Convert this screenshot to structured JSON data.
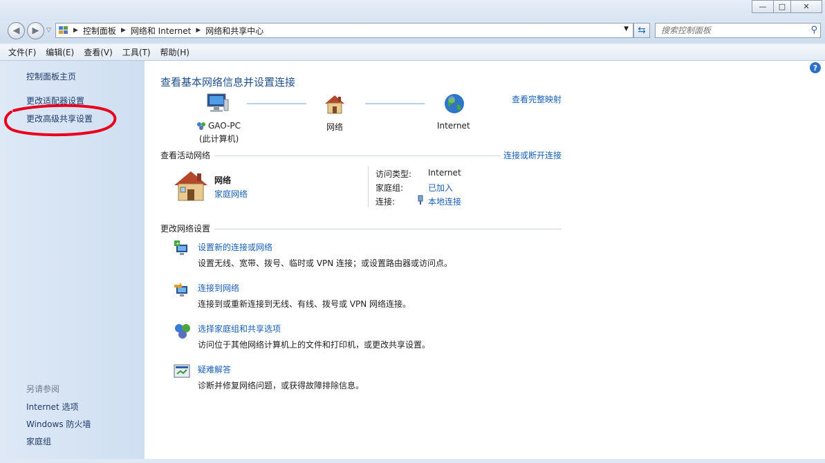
{
  "window": {
    "minimize_label": "—",
    "maximize_label": "□",
    "close_label": "✕"
  },
  "nav": {
    "back_label": "◀",
    "forward_label": "▶",
    "breadcrumb": [
      "控制面板",
      "网络和 Internet",
      "网络和共享中心"
    ],
    "search_placeholder": "搜索控制面板"
  },
  "menu": [
    "文件(F)",
    "编辑(E)",
    "查看(V)",
    "工具(T)",
    "帮助(H)"
  ],
  "sidebar": {
    "home": "控制面板主页",
    "items": [
      "更改适配器设置",
      "更改高级共享设置"
    ],
    "see_also_heading": "另请参阅",
    "see_also": [
      "Internet 选项",
      "Windows 防火墙",
      "家庭组"
    ]
  },
  "main": {
    "title": "查看基本网络信息并设置连接",
    "full_map_link": "查看完整映射",
    "map": {
      "computer_name": "GAO-PC",
      "computer_sub": "(此计算机)",
      "network": "网络",
      "internet": "Internet"
    },
    "active": {
      "title": "查看活动网络",
      "connect_link": "连接或断开连接",
      "network_name": "网络",
      "network_type": "家庭网络",
      "access_type_label": "访问类型:",
      "access_type_value": "Internet",
      "homegroup_label": "家庭组:",
      "homegroup_value": "已加入",
      "connection_label": "连接:",
      "connection_value": "本地连接"
    },
    "change": {
      "title": "更改网络设置",
      "tasks": [
        {
          "title": "设置新的连接或网络",
          "desc": "设置无线、宽带、拨号、临时或 VPN 连接；或设置路由器或访问点。"
        },
        {
          "title": "连接到网络",
          "desc": "连接到或重新连接到无线、有线、拨号或 VPN 网络连接。"
        },
        {
          "title": "选择家庭组和共享选项",
          "desc": "访问位于其他网络计算机上的文件和打印机，或更改共享设置。"
        },
        {
          "title": "疑难解答",
          "desc": "诊断并修复网络问题，或获得故障排除信息。"
        }
      ]
    },
    "help_label": "?"
  },
  "colors": {
    "link": "#1a5fb4",
    "title": "#1f4e8c",
    "annotation": "#e8001c"
  }
}
